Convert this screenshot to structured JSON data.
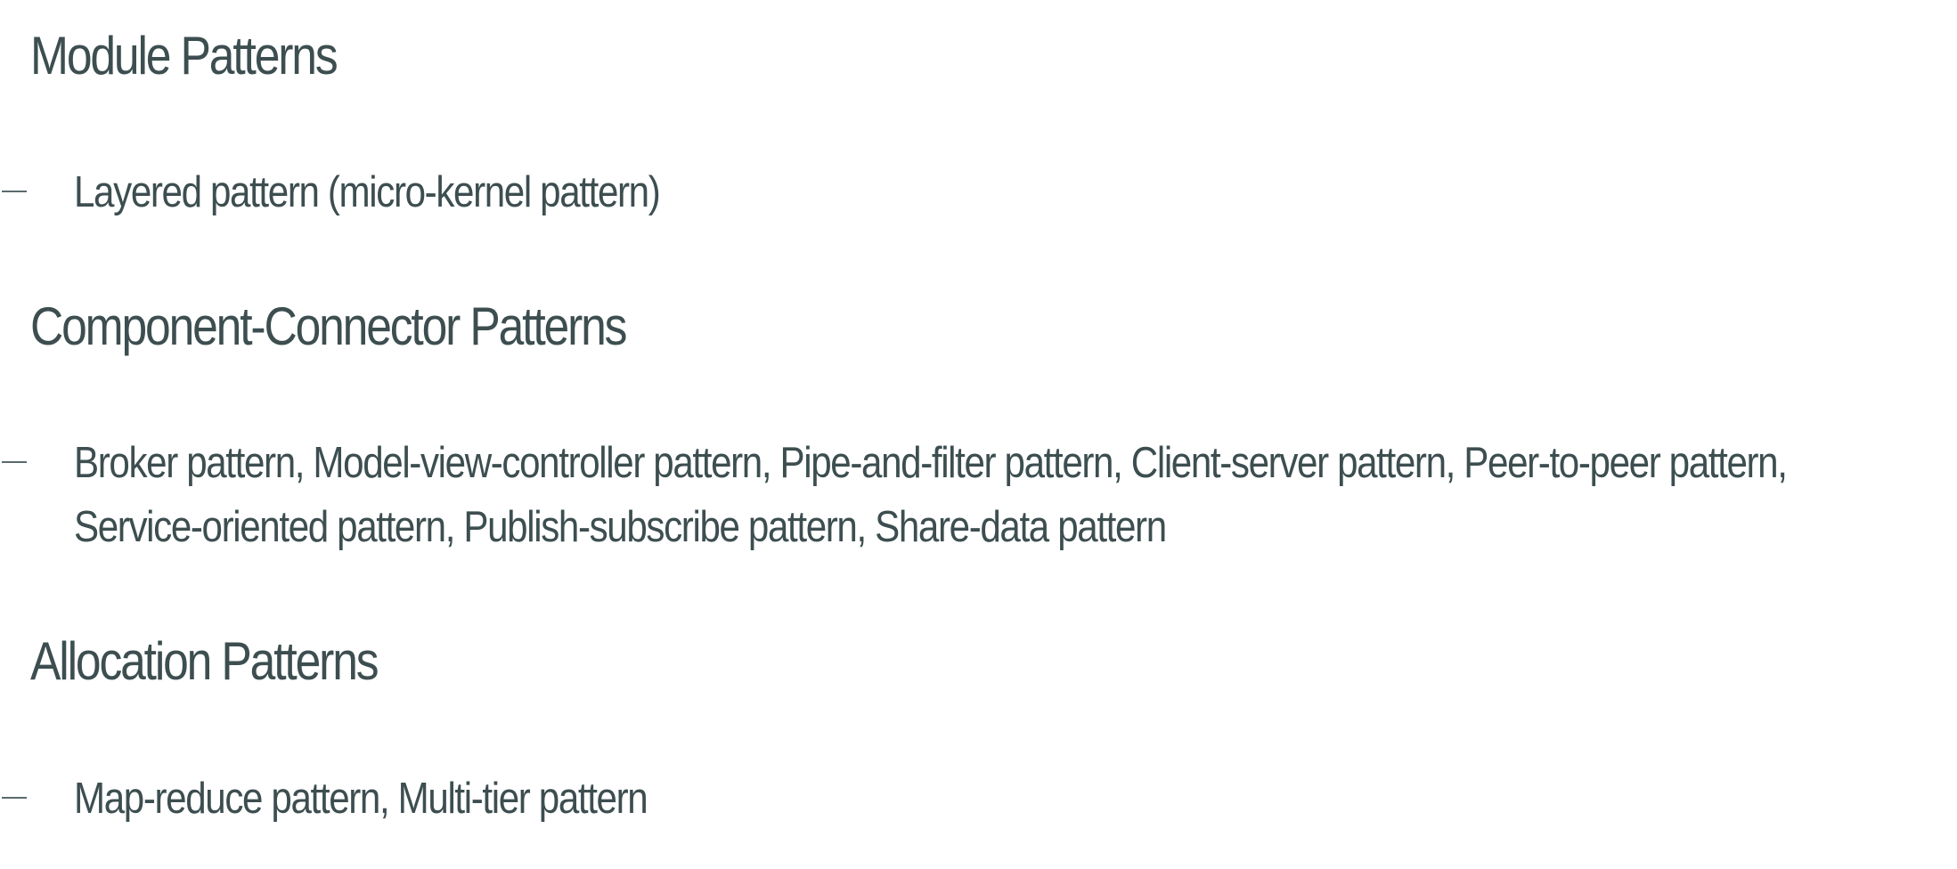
{
  "sections": [
    {
      "heading": "Module Patterns",
      "items": [
        "Layered pattern (micro-kernel pattern)"
      ]
    },
    {
      "heading": "Component-Connector Patterns",
      "items": [
        "Broker pattern, Model-view-controller pattern, Pipe-and-filter pattern, Client-server pattern, Peer-to-peer pattern,",
        "Service-oriented pattern, Publish-subscribe pattern, Share-data pattern"
      ]
    },
    {
      "heading": "Allocation Patterns",
      "items": [
        "Map-reduce pattern, Multi-tier pattern"
      ]
    }
  ],
  "colors": {
    "text": "#3d4e50",
    "bullet_dash": "#5a6a6c",
    "background": "#ffffff"
  }
}
